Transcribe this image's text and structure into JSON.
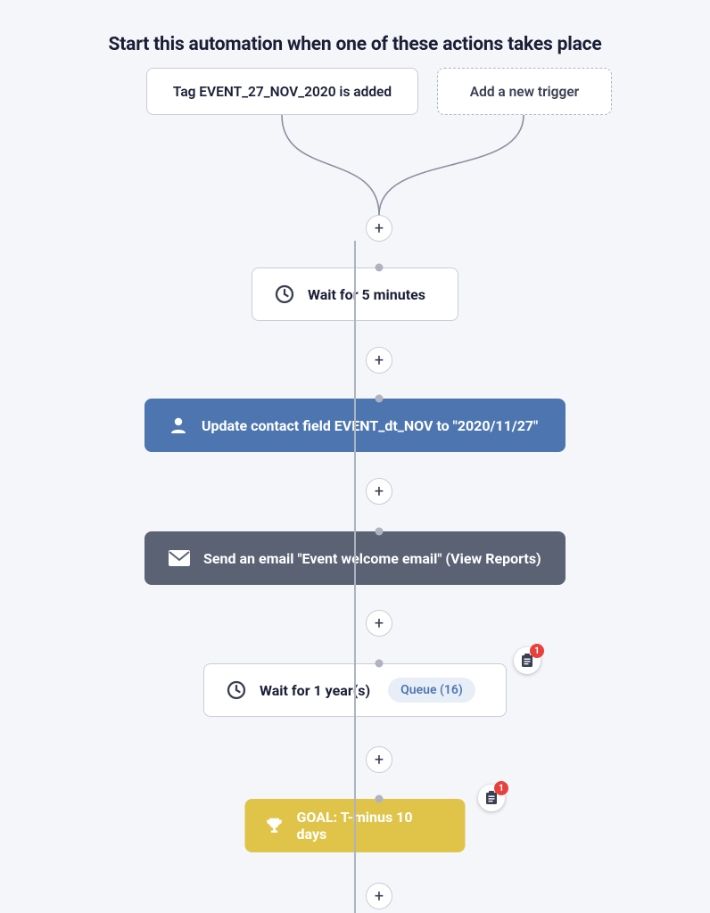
{
  "header": "Start this automation when one of these actions takes place",
  "triggers": {
    "existing": "Tag EVENT_27_NOV_2020 is added",
    "add_new": "Add a new trigger"
  },
  "steps": {
    "wait1": "Wait for 5 minutes",
    "update": "Update contact field EVENT_dt_NOV to \"2020/11/27\"",
    "email": "Send an email \"Event welcome email\" (View Reports)",
    "wait2": "Wait for 1 year(s)",
    "queue": "Queue (16)",
    "goal": "GOAL: T-minus 10 days"
  },
  "badges": {
    "note_count_1": "1",
    "note_count_2": "1"
  },
  "plus": "+"
}
